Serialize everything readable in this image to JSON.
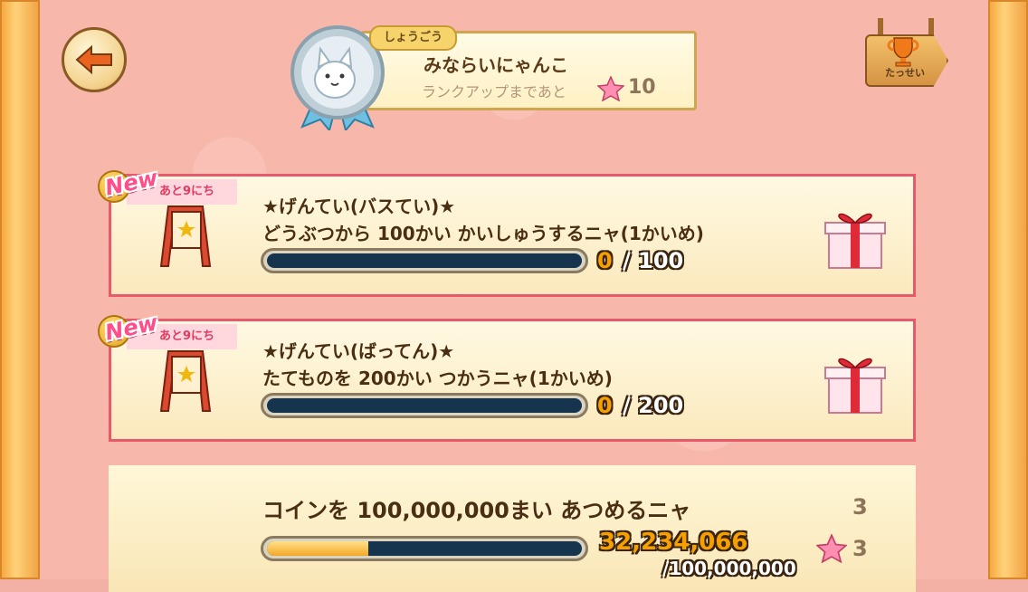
{
  "header": {
    "rank_tag": "しょうごう",
    "rank_title": "みならいにゃんこ",
    "rank_sub": "ランクアップまであと",
    "rank_remaining": "10",
    "trophy_label": "たっせい"
  },
  "missions": [
    {
      "days": "あと9にち",
      "badge": "New",
      "title": "★げんてい(バスてい)★",
      "desc": "どうぶつから 100かい かいしゅうするニャ(1かいめ)",
      "progress_current": "0",
      "progress_total": "/ 100",
      "progress_fraction": 0
    },
    {
      "days": "あと9にち",
      "badge": "New",
      "title": "★げんてい(ばってん)★",
      "desc": "たてものを 200かい つかうニャ(1かいめ)",
      "progress_current": "0",
      "progress_total": "/ 200",
      "progress_fraction": 0
    },
    {
      "title": "コインを 100,000,000まい あつめるニャ",
      "progress_current": "32,234,066",
      "progress_total": "/100,000,000",
      "progress_fraction": 0.322,
      "level": "3",
      "reward_stars": "3"
    }
  ]
}
